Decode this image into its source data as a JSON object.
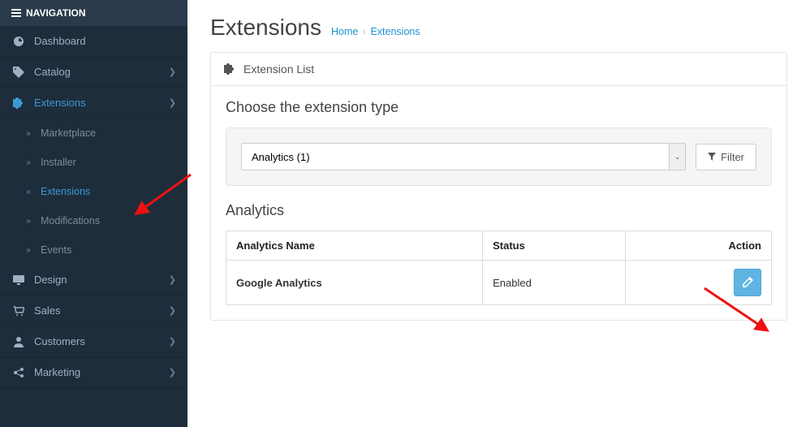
{
  "sidebar": {
    "header": "NAVIGATION",
    "items": [
      {
        "label": "Dashboard"
      },
      {
        "label": "Catalog"
      },
      {
        "label": "Extensions"
      },
      {
        "label": "Design"
      },
      {
        "label": "Sales"
      },
      {
        "label": "Customers"
      },
      {
        "label": "Marketing"
      }
    ],
    "sub_items": [
      {
        "label": "Marketplace"
      },
      {
        "label": "Installer"
      },
      {
        "label": "Extensions"
      },
      {
        "label": "Modifications"
      },
      {
        "label": "Events"
      }
    ]
  },
  "header": {
    "title": "Extensions",
    "breadcrumb_home": "Home",
    "breadcrumb_current": "Extensions"
  },
  "panel": {
    "heading": "Extension List",
    "choose_title": "Choose the extension type",
    "select_value": "Analytics (1)",
    "filter_label": "Filter",
    "analytics_title": "Analytics",
    "columns": {
      "name": "Analytics Name",
      "status": "Status",
      "action": "Action"
    },
    "rows": [
      {
        "name": "Google Analytics",
        "status": "Enabled"
      }
    ]
  }
}
